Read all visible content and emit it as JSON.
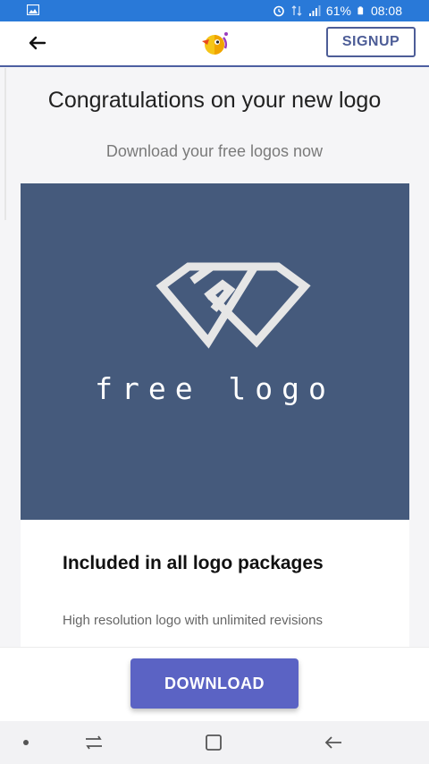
{
  "status_bar": {
    "battery": "61%",
    "time": "08:08"
  },
  "app_bar": {
    "signup_label": "SIGNUP"
  },
  "main": {
    "title": "Congratulations on your new logo",
    "subtitle": "Download your free logos now",
    "logo_preview": {
      "text": "free logo",
      "background": "#455a7c"
    },
    "package": {
      "title": "Included in all logo packages",
      "description": "High resolution logo with unlimited revisions"
    }
  },
  "footer": {
    "download_label": "DOWNLOAD"
  },
  "colors": {
    "status_bar": "#2979d8",
    "accent": "#5b63c4",
    "signup_border": "#4d5d97"
  }
}
